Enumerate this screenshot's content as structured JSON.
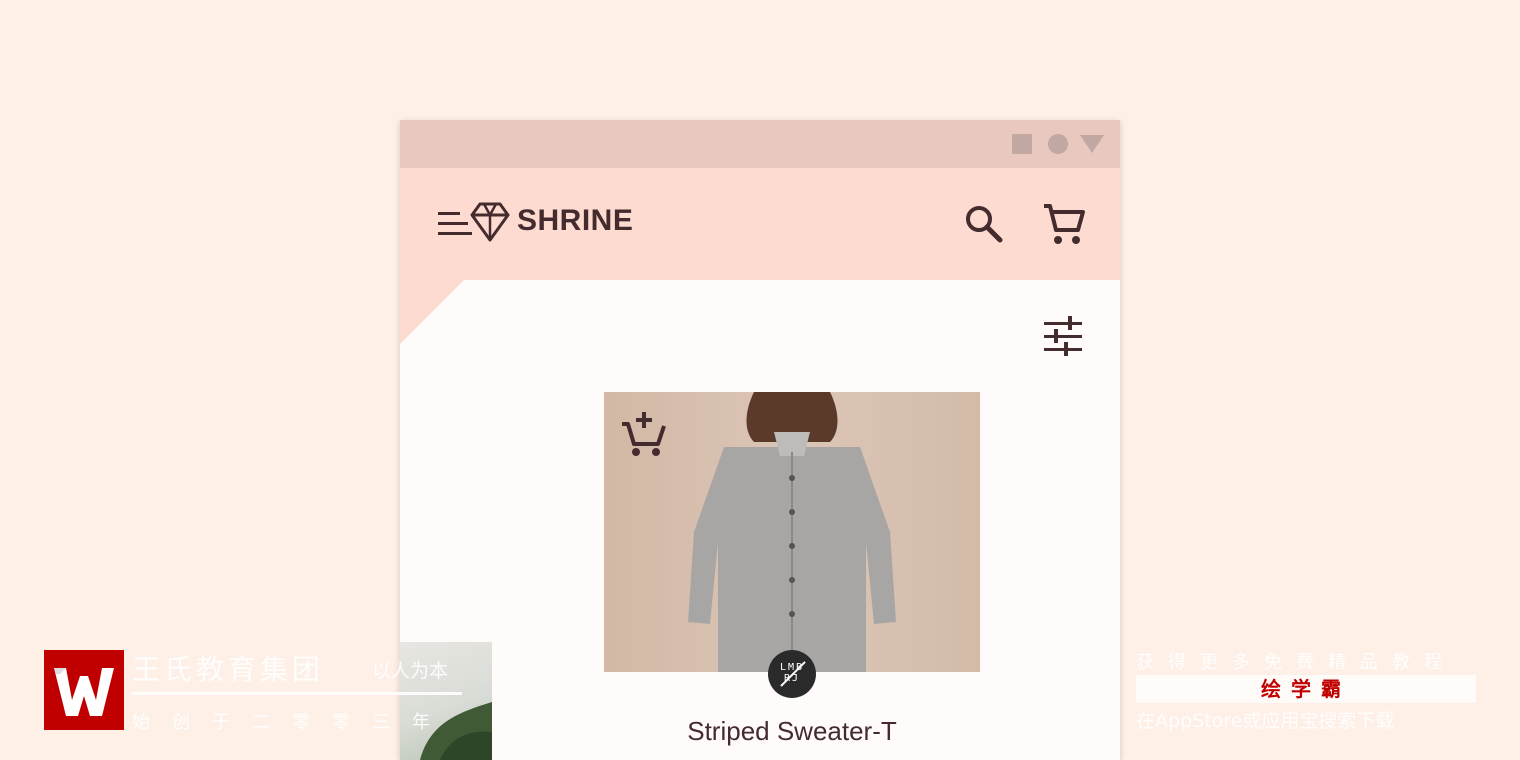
{
  "app": {
    "brand": "SHRINE",
    "product_name": "Striped Sweater-T",
    "vendor_logo_text": "LMB RJ"
  },
  "icons": {
    "menu": "menu-icon",
    "brand_logo": "diamond-icon",
    "search": "search-icon",
    "cart": "shopping-cart-icon",
    "filter": "tune-icon",
    "add_to_cart": "add-shopping-cart-icon",
    "window_controls": [
      "square-icon",
      "circle-icon",
      "triangle-icon"
    ]
  },
  "colors": {
    "page_background": "#fef0e7",
    "title_bar": "#e8c8bf",
    "app_bar": "#fedbd0",
    "surface": "#fffbfa",
    "text_primary": "#442c2e"
  },
  "watermark_left": {
    "title": "王氏教育集团",
    "motto": "以人为本",
    "subtitle": "始创于二零零三年"
  },
  "watermark_right": {
    "line1": "获得更多免费精品教程",
    "brand": "绘学霸",
    "line3": "在AppStore或应用宝搜索下载"
  }
}
